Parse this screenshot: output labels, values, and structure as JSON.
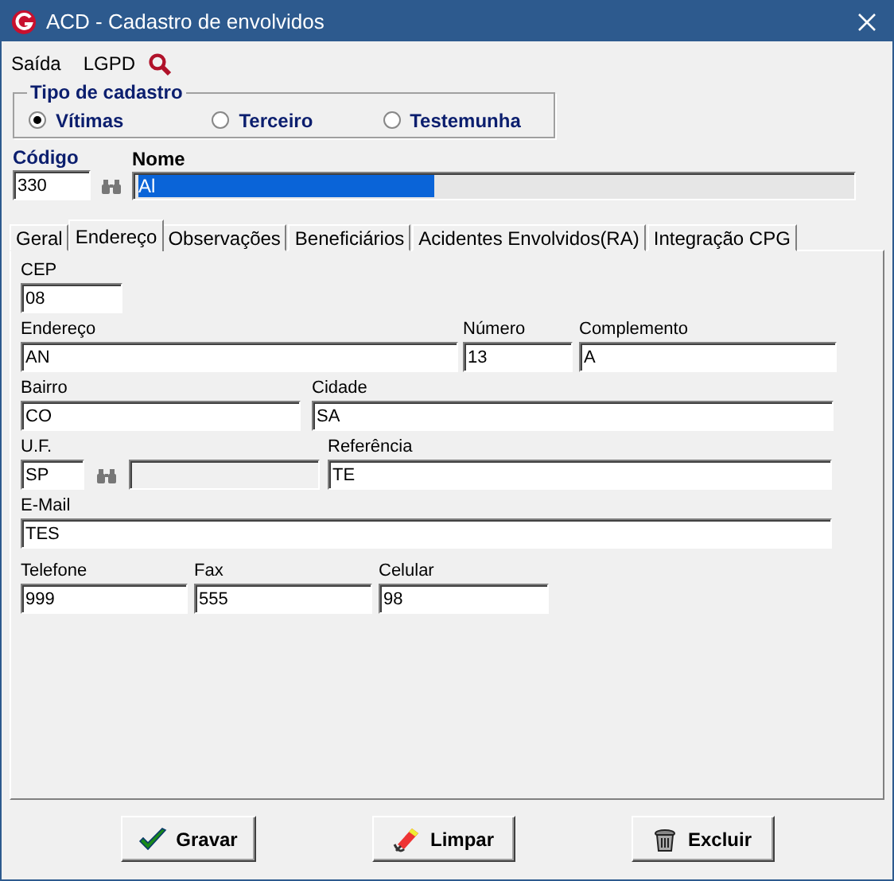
{
  "window": {
    "title": "ACD - Cadastro de envolvidos"
  },
  "menu": [
    "Saída",
    "LGPD"
  ],
  "tipo_cadastro": {
    "title": "Tipo de cadastro",
    "options": [
      {
        "label": "Vítimas",
        "selected": true
      },
      {
        "label": "Terceiro",
        "selected": false
      },
      {
        "label": "Testemunha",
        "selected": false
      }
    ]
  },
  "codigo": {
    "label": "Código",
    "value": "330"
  },
  "nome": {
    "label": "Nome",
    "value": "Al",
    "selected": true
  },
  "tabs": [
    {
      "label": "Geral",
      "selected": false
    },
    {
      "label": "Endereço",
      "selected": true
    },
    {
      "label": "Observações",
      "selected": false
    },
    {
      "label": "Beneficiários",
      "selected": false
    },
    {
      "label": "Acidentes Envolvidos(RA)",
      "selected": false
    },
    {
      "label": "Integração CPG",
      "selected": false
    }
  ],
  "fields": {
    "cep": {
      "label": "CEP",
      "value": "08"
    },
    "endereco": {
      "label": "Endereço",
      "value": "AN"
    },
    "numero": {
      "label": "Número",
      "value": "13"
    },
    "complemento": {
      "label": "Complemento",
      "value": "A"
    },
    "bairro": {
      "label": "Bairro",
      "value": "CO"
    },
    "cidade": {
      "label": "Cidade",
      "value": "SA"
    },
    "uf": {
      "label": "U.F.",
      "value": "SP"
    },
    "referencia": {
      "label": "Referência",
      "value": "TE"
    },
    "email": {
      "label": "E-Mail",
      "value": "TES"
    },
    "telefone": {
      "label": "Telefone",
      "value": "999"
    },
    "fax": {
      "label": "Fax",
      "value": "555"
    },
    "celular": {
      "label": "Celular",
      "value": "98"
    }
  },
  "buttons": [
    {
      "kind": "save",
      "label": "Gravar"
    },
    {
      "kind": "clear",
      "label": "Limpar"
    },
    {
      "kind": "delete",
      "label": "Excluir"
    }
  ]
}
